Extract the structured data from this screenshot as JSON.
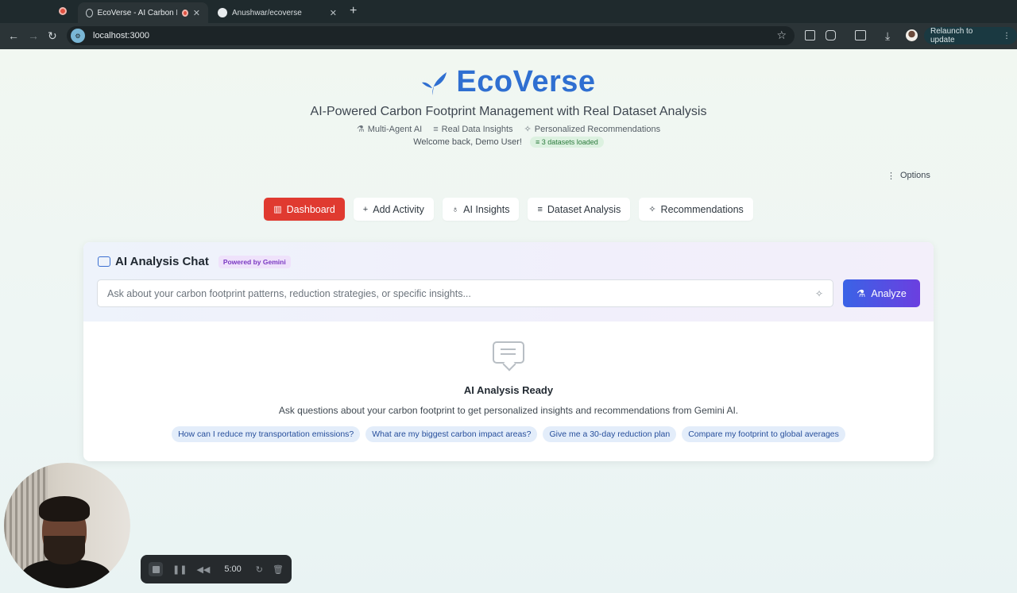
{
  "browser": {
    "tabs": [
      {
        "title": "EcoVerse - AI Carbon Footprint",
        "active": true
      },
      {
        "title": "Anushwar/ecoverse",
        "active": false
      }
    ],
    "url": "localhost:3000",
    "relaunch_label": "Relaunch to update"
  },
  "header": {
    "brand": "EcoVerse",
    "subtitle": "AI-Powered Carbon Footprint Management with Real Dataset Analysis",
    "features": [
      "Multi-Agent AI",
      "Real Data Insights",
      "Personalized Recommendations"
    ],
    "welcome": "Welcome back, Demo User!",
    "datasets_badge": "3 datasets loaded",
    "options_label": "Options"
  },
  "nav": {
    "tabs": [
      {
        "label": "Dashboard",
        "icon": "chart-icon",
        "active": true
      },
      {
        "label": "Add Activity",
        "icon": "plus-icon",
        "active": false
      },
      {
        "label": "AI Insights",
        "icon": "lightbulb-icon",
        "active": false
      },
      {
        "label": "Dataset Analysis",
        "icon": "database-icon",
        "active": false
      },
      {
        "label": "Recommendations",
        "icon": "sparkles-icon",
        "active": false
      }
    ]
  },
  "chat": {
    "title": "AI Analysis Chat",
    "badge": "Powered by Gemini",
    "placeholder": "Ask about your carbon footprint patterns, reduction strategies, or specific insights...",
    "analyze_label": "Analyze",
    "empty_title": "AI Analysis Ready",
    "empty_sub": "Ask questions about your carbon footprint to get personalized insights and recommendations from Gemini AI.",
    "suggestions": [
      "How can I reduce my transportation emissions?",
      "What are my biggest carbon impact areas?",
      "Give me a 30-day reduction plan",
      "Compare my footprint to global averages"
    ]
  },
  "recorder": {
    "time": "5:00"
  },
  "colors": {
    "brand": "#2f6fd1",
    "active_tab": "#e03a30",
    "analyze_start": "#3a63e6",
    "analyze_end": "#6b3fe0"
  }
}
